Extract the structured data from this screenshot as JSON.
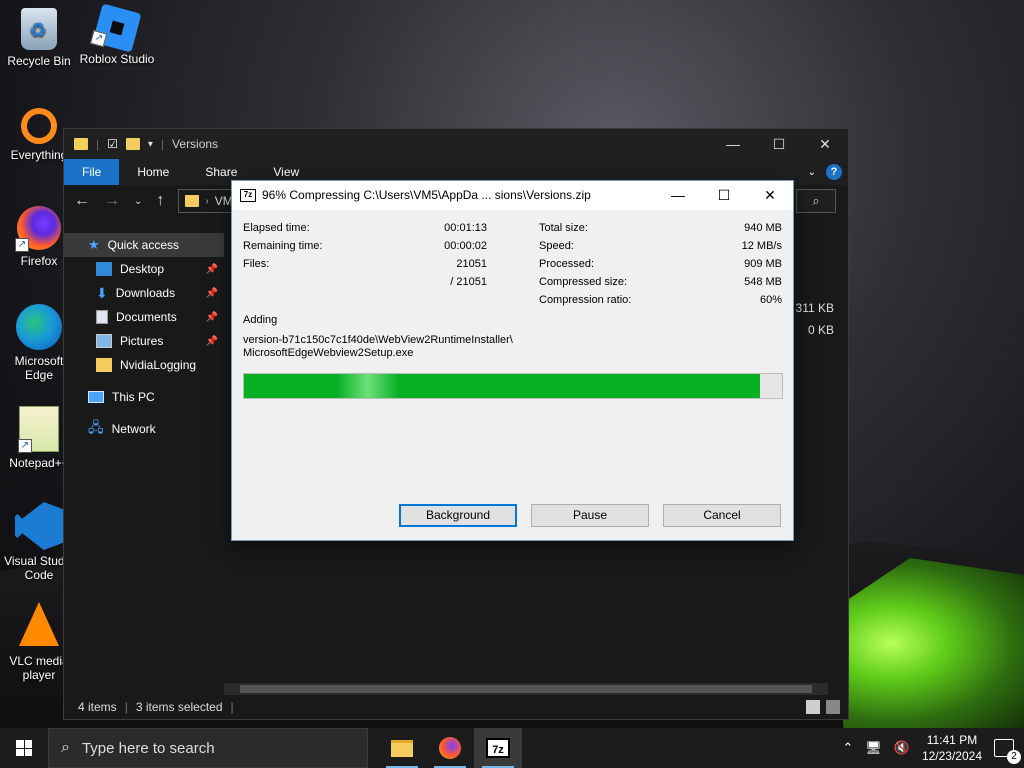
{
  "desktop": {
    "icons": [
      {
        "label": "Recycle Bin"
      },
      {
        "label": "Roblox Studio"
      },
      {
        "label": "Everything"
      },
      {
        "label": "Firefox"
      },
      {
        "label": "Microsoft Edge"
      },
      {
        "label": "Notepad++"
      },
      {
        "label": "Visual Studio Code"
      },
      {
        "label": "VLC media player"
      }
    ]
  },
  "explorer": {
    "title": "Versions",
    "ribbon_tabs": [
      "File",
      "Home",
      "Share",
      "View"
    ],
    "address_text": "VM",
    "nav": [
      {
        "label": "Quick access"
      },
      {
        "label": "Desktop"
      },
      {
        "label": "Downloads"
      },
      {
        "label": "Documents"
      },
      {
        "label": "Pictures"
      },
      {
        "label": "NvidiaLogging"
      },
      {
        "label": "This PC"
      },
      {
        "label": "Network"
      }
    ],
    "visible_sizes": [
      "311 KB",
      "0 KB"
    ],
    "status": {
      "items": "4 items",
      "selected": "3 items selected"
    }
  },
  "dialog": {
    "app_icon": "7z",
    "title": "96% Compressing C:\\Users\\VM5\\AppDa ... sions\\Versions.zip",
    "left_stats": [
      {
        "k": "Elapsed time:",
        "v": "00:01:13"
      },
      {
        "k": "Remaining time:",
        "v": "00:00:02"
      },
      {
        "k": "Files:",
        "v": "21051"
      },
      {
        "k": "",
        "v": "/ 21051"
      }
    ],
    "right_stats": [
      {
        "k": "Total size:",
        "v": "940 MB"
      },
      {
        "k": "Speed:",
        "v": "12 MB/s"
      },
      {
        "k": "Processed:",
        "v": "909 MB"
      },
      {
        "k": "Compressed size:",
        "v": "548 MB"
      },
      {
        "k": "Compression ratio:",
        "v": "60%"
      }
    ],
    "adding_label": "Adding",
    "path_line1": "version-b71c150c7c1f40de\\WebView2RuntimeInstaller\\",
    "path_line2": "MicrosoftEdgeWebview2Setup.exe",
    "progress_fraction": 0.96,
    "buttons": {
      "background": "Background",
      "pause": "Pause",
      "cancel": "Cancel"
    },
    "progress_color": "#06b025"
  },
  "taskbar": {
    "search_placeholder": "Type here to search",
    "time": "11:41 PM",
    "date": "12/23/2024",
    "notification_count": "2"
  }
}
